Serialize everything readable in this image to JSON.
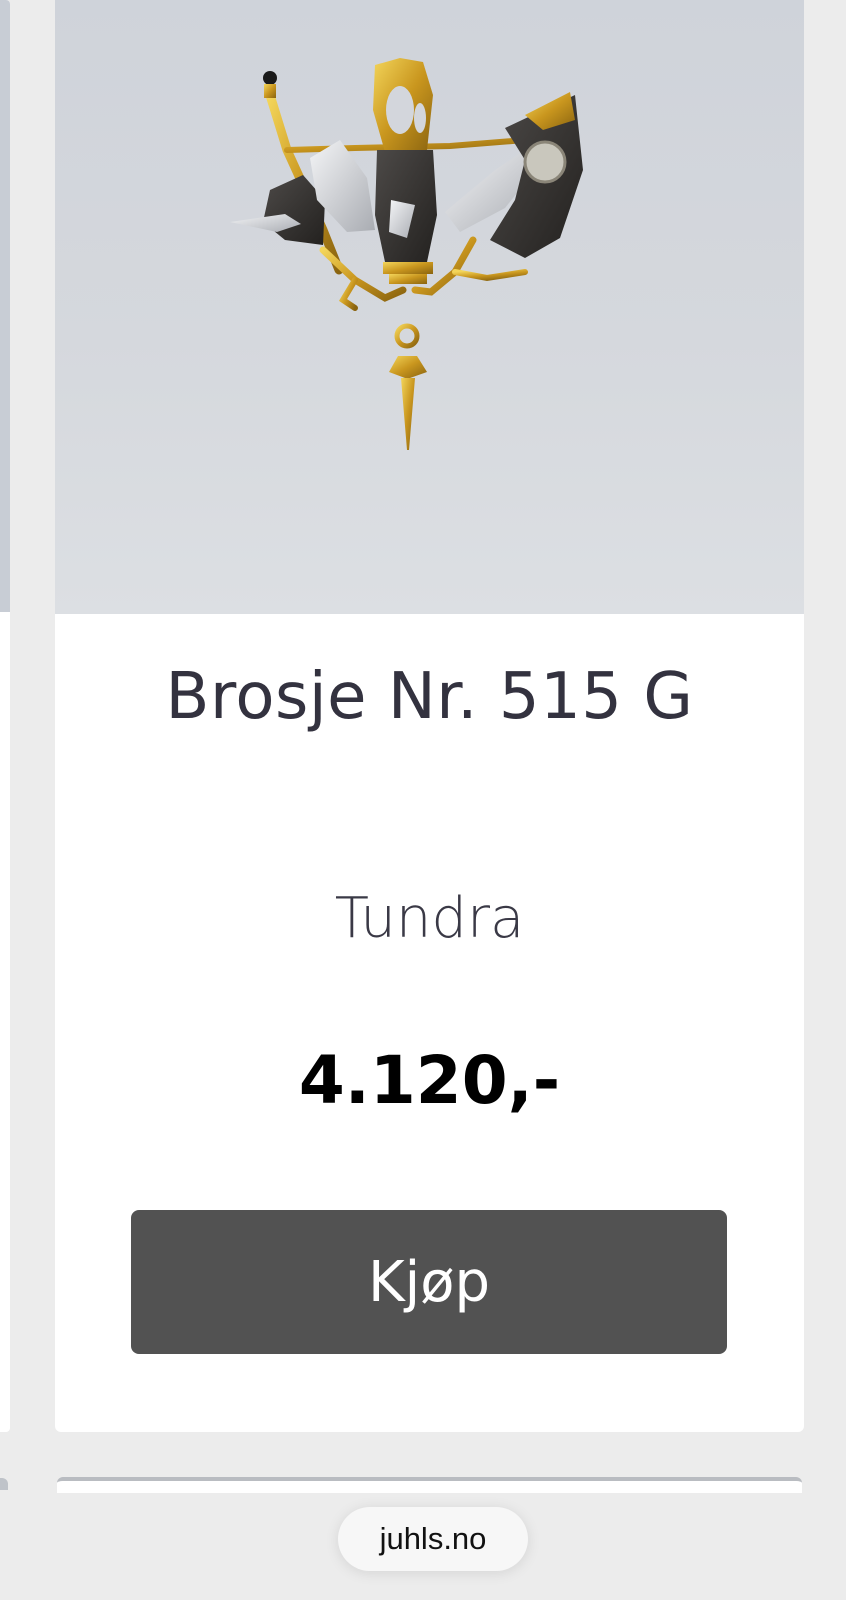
{
  "product": {
    "title": "Brosje Nr. 515 G",
    "collection": "Tundra",
    "price": "4.120,-",
    "buy_label": "Kjøp"
  },
  "browser": {
    "url": "juhls.no"
  },
  "colors": {
    "title_text": "#33323f",
    "button_bg": "#525252",
    "button_text": "#ffffff",
    "page_bg": "#ececec",
    "gold": "#d4a92a",
    "silver": "#e6e7e9",
    "oxidized": "#3c3a3a"
  }
}
